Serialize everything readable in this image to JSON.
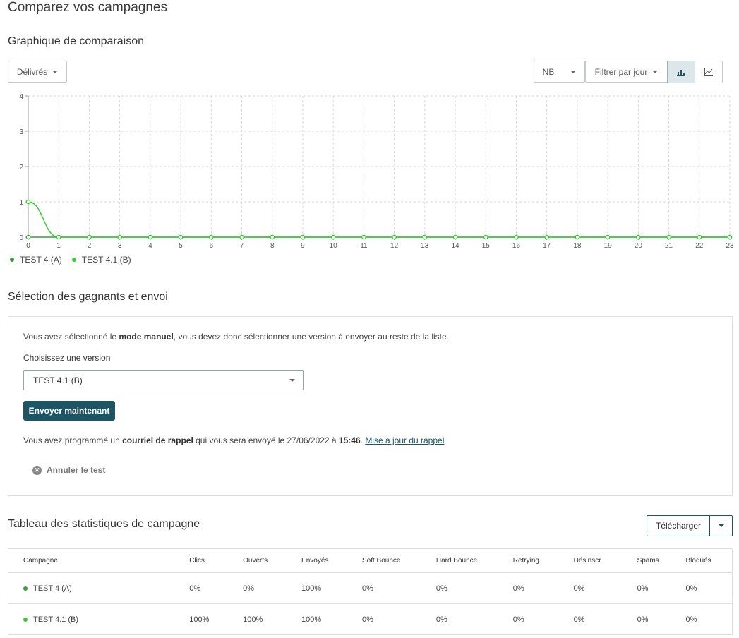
{
  "page": {
    "title": "Comparez vos campagnes"
  },
  "comparison": {
    "title": "Graphique de comparaison",
    "metric_dropdown": "Délivrés",
    "unit_dropdown": "NB",
    "period_dropdown": "Filtrer par jour",
    "view_toggle": {
      "active": "bar-chart",
      "icons": [
        "bar-chart-icon",
        "line-chart-icon"
      ]
    }
  },
  "chart_data": {
    "type": "line",
    "x": [
      0,
      1,
      2,
      3,
      4,
      5,
      6,
      7,
      8,
      9,
      10,
      11,
      12,
      13,
      14,
      15,
      16,
      17,
      18,
      19,
      20,
      21,
      22,
      23
    ],
    "series": [
      {
        "name": "TEST 4 (A)",
        "color": "#3a9c3f",
        "values": [
          0,
          0,
          0,
          0,
          0,
          0,
          0,
          0,
          0,
          0,
          0,
          0,
          0,
          0,
          0,
          0,
          0,
          0,
          0,
          0,
          0,
          0,
          0,
          0
        ]
      },
      {
        "name": "TEST 4.1 (B)",
        "color": "#33cc33",
        "values": [
          1,
          0,
          0,
          0,
          0,
          0,
          0,
          0,
          0,
          0,
          0,
          0,
          0,
          0,
          0,
          0,
          0,
          0,
          0,
          0,
          0,
          0,
          0,
          0
        ]
      }
    ],
    "yticks": [
      0,
      1,
      2,
      3,
      4
    ],
    "ylim": [
      0,
      4
    ],
    "xlim": [
      0,
      23
    ],
    "grid": true,
    "legend_position": "bottom-left"
  },
  "winner": {
    "title": "Sélection des gagnants et envoi",
    "intro_prefix": "Vous avez sélectionné le ",
    "intro_bold": "mode manuel",
    "intro_suffix": ", vous devez donc sélectionner une version à envoyer au reste de la liste.",
    "choose_label": "Choisissez une version",
    "selected_version": "TEST 4.1 (B)",
    "send_button": "Envoyer maintenant",
    "reminder_prefix": "Vous avez programmé un ",
    "reminder_bold": "courriel de rappel",
    "reminder_middle": " qui vous sera envoyé le ",
    "reminder_date": "27/06/2022",
    "reminder_at": " à ",
    "reminder_time": "15:46",
    "reminder_dot": ". ",
    "reminder_link": "Mise à jour du rappel",
    "cancel_label": "Annuler le test"
  },
  "stats": {
    "title": "Tableau des statistiques de campagne",
    "download_label": "Télécharger",
    "columns": [
      "Campagne",
      "Clics",
      "Ouverts",
      "Envoyés",
      "Soft Bounce",
      "Hard Bounce",
      "Retrying",
      "Désinscr.",
      "Spams",
      "Bloqués"
    ],
    "rows": [
      {
        "color": "#3a9c3f",
        "cells": [
          "TEST 4 (A)",
          "0%",
          "0%",
          "100%",
          "0%",
          "0%",
          "0%",
          "0%",
          "0%",
          "0%"
        ]
      },
      {
        "color": "#33cc33",
        "cells": [
          "TEST 4.1 (B)",
          "100%",
          "100%",
          "100%",
          "0%",
          "0%",
          "0%",
          "0%",
          "0%",
          "0%"
        ]
      }
    ]
  }
}
